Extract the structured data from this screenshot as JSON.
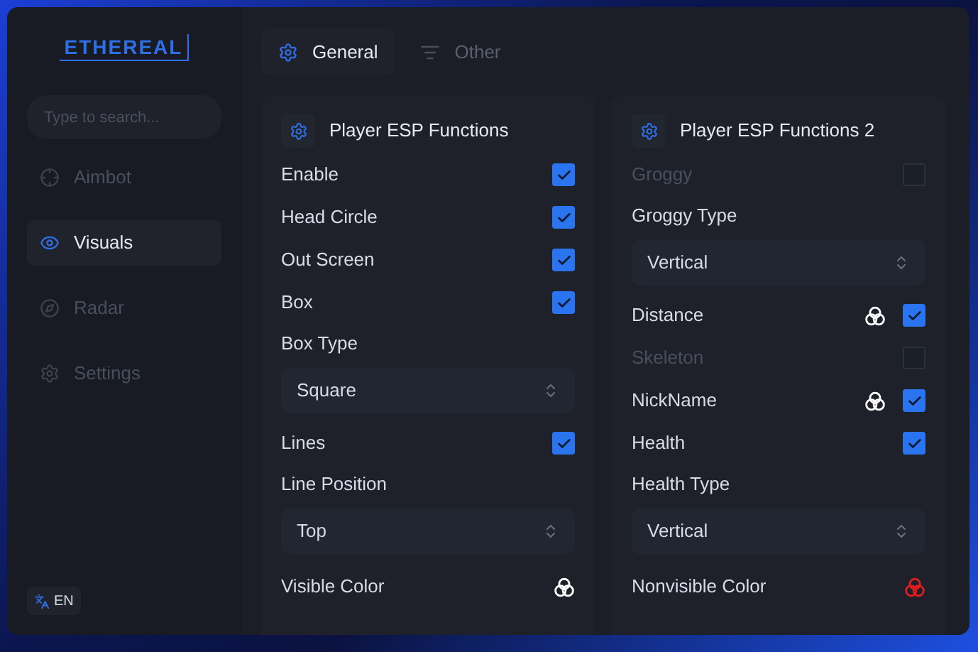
{
  "logo": "ETHEREAL",
  "search": {
    "placeholder": "Type to search..."
  },
  "nav": [
    {
      "label": "Aimbot",
      "selected": false
    },
    {
      "label": "Visuals",
      "selected": true
    },
    {
      "label": "Radar",
      "selected": false
    },
    {
      "label": "Settings",
      "selected": false
    }
  ],
  "language": "EN",
  "tabs": [
    {
      "label": "General",
      "selected": true
    },
    {
      "label": "Other",
      "selected": false
    }
  ],
  "panels": [
    {
      "title": "Player ESP Functions",
      "items": [
        {
          "kind": "toggle",
          "label": "Enable",
          "checked": true,
          "disabled": false
        },
        {
          "kind": "toggle",
          "label": "Head Circle",
          "checked": true,
          "disabled": false
        },
        {
          "kind": "toggle",
          "label": "Out Screen",
          "checked": true,
          "disabled": false
        },
        {
          "kind": "toggle",
          "label": "Box",
          "checked": true,
          "disabled": false
        },
        {
          "kind": "heading",
          "label": "Box Type"
        },
        {
          "kind": "select",
          "value": "Square"
        },
        {
          "kind": "toggle",
          "label": "Lines",
          "checked": true,
          "disabled": false
        },
        {
          "kind": "heading",
          "label": "Line Position"
        },
        {
          "kind": "select",
          "value": "Top"
        },
        {
          "kind": "color",
          "label": "Visible Color",
          "color": "#ffffff"
        }
      ]
    },
    {
      "title": "Player ESP Functions 2",
      "items": [
        {
          "kind": "toggle",
          "label": "Groggy",
          "checked": false,
          "disabled": true
        },
        {
          "kind": "heading",
          "label": "Groggy Type"
        },
        {
          "kind": "select",
          "value": "Vertical"
        },
        {
          "kind": "toggle",
          "label": "Distance",
          "checked": true,
          "disabled": false,
          "color": "#ffffff"
        },
        {
          "kind": "toggle",
          "label": "Skeleton",
          "checked": false,
          "disabled": true
        },
        {
          "kind": "toggle",
          "label": "NickName",
          "checked": true,
          "disabled": false,
          "color": "#ffffff"
        },
        {
          "kind": "toggle",
          "label": "Health",
          "checked": true,
          "disabled": false
        },
        {
          "kind": "heading",
          "label": "Health Type"
        },
        {
          "kind": "select",
          "value": "Vertical"
        },
        {
          "kind": "color",
          "label": "Nonvisible Color",
          "color": "#e11d1d"
        }
      ]
    }
  ]
}
